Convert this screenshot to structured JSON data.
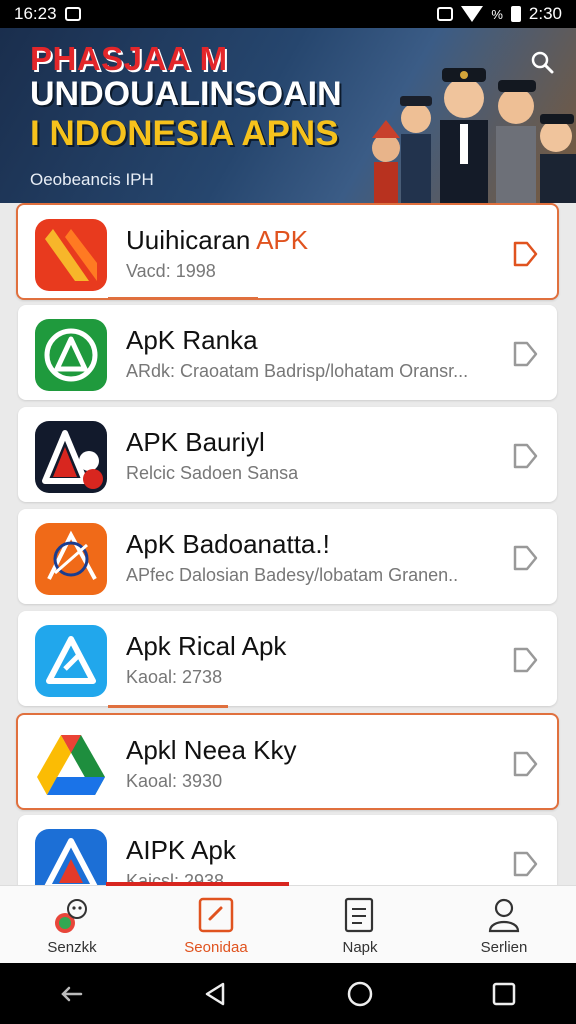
{
  "status_bar": {
    "time": "16:23",
    "right_pct": "%",
    "clock": "2:30"
  },
  "banner": {
    "title_line1": "PHASJAA M",
    "title_line2": "UNDOUALINSOAIN",
    "title_line3": "I NDONESIA APNS",
    "subtitle": "Oeobeancis IPH",
    "search_icon": "search-icon"
  },
  "apps": [
    {
      "name": "Uuihicaran",
      "name_accent": "APK",
      "sub": "Vacd: 1998",
      "icon": "orange-fold-icon",
      "bg": "#e83a1e"
    },
    {
      "name": "ApK Ranka",
      "name_accent": "",
      "sub": "ARdk: Craoatam Badrisp/lohatam Oransr...",
      "icon": "green-triangle-icon",
      "bg": "#1f9a3d"
    },
    {
      "name": "APK Bauriyl",
      "name_accent": "",
      "sub": "Relcic Sadoen Sansa",
      "icon": "red-triangle-icon",
      "bg": "#121a2c"
    },
    {
      "name": "ApK Badoanatta.!",
      "name_accent": "",
      "sub": "APfec Dalosian Badesy/lobatam Granen..",
      "icon": "orange-compass-icon",
      "bg": "#f06a18"
    },
    {
      "name": "Apk Rical Apk",
      "name_accent": "",
      "sub": "Kaoal: 2738",
      "icon": "blue-triangle-icon",
      "bg": "#21a7ec"
    },
    {
      "name": "Apkl Neea Kky",
      "name_accent": "",
      "sub": "Kaoal: 3930",
      "icon": "drive-triangle-icon",
      "bg": "#ffffff"
    },
    {
      "name": "AIPK Apk",
      "name_accent": "",
      "sub": "Kaicsl: 2938",
      "icon": "blue-red-triangle-icon",
      "bg": "#1c6fd6"
    }
  ],
  "bottom_nav": [
    {
      "label": "Senzkk",
      "icon": "robot-icon"
    },
    {
      "label": "Seonidaa",
      "icon": "edit-icon"
    },
    {
      "label": "Napk",
      "icon": "document-icon"
    },
    {
      "label": "Serlien",
      "icon": "user-icon"
    }
  ],
  "colors": {
    "accent": "#e0531f",
    "selected_border": "#e0703e",
    "progress": "#d8261f"
  }
}
